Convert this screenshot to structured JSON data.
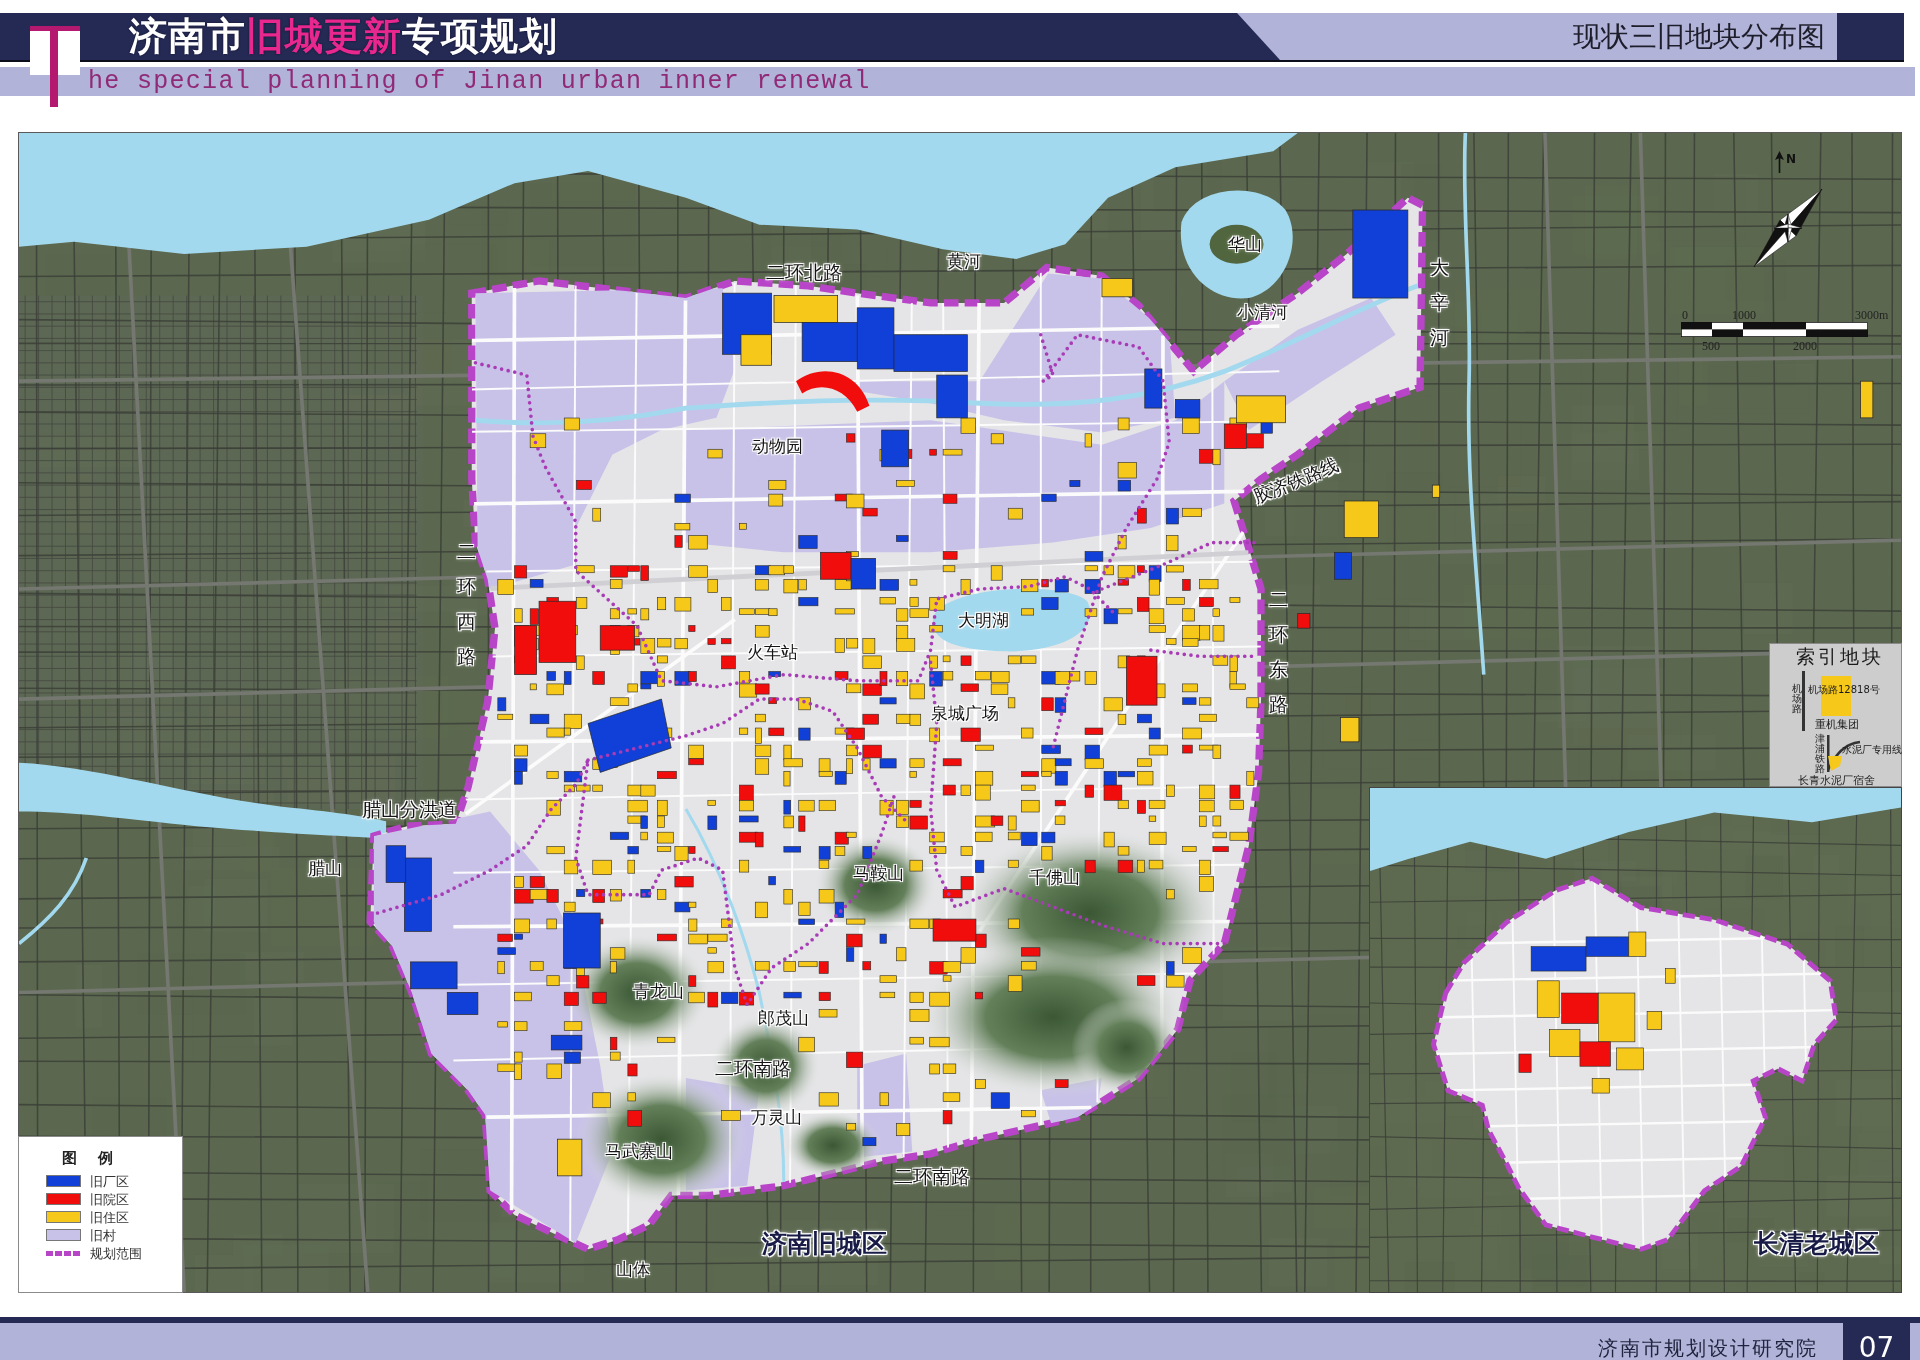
{
  "header": {
    "title_parts": [
      {
        "text": "济南市",
        "highlight": false
      },
      {
        "text": "旧城更新",
        "highlight": true
      },
      {
        "text": "专项规划",
        "highlight": false
      }
    ],
    "subtitle": "he special planning of Jinan urban inner renewal",
    "sheet_title": "现状三旧地块分布图"
  },
  "map": {
    "labels": [
      {
        "text": "二环北路",
        "kind": "road"
      },
      {
        "text": "黄河",
        "kind": "place"
      },
      {
        "text": "华山",
        "kind": "place"
      },
      {
        "text": "小清河",
        "kind": "place"
      },
      {
        "text": "大辛河",
        "kind": "vertical"
      },
      {
        "text": "胶济铁路线",
        "kind": "slanted"
      },
      {
        "text": "动物园",
        "kind": "place"
      },
      {
        "text": "二环西路",
        "kind": "vertical"
      },
      {
        "text": "大明湖",
        "kind": "place"
      },
      {
        "text": "火车站",
        "kind": "place"
      },
      {
        "text": "泉城广场",
        "kind": "place"
      },
      {
        "text": "二环东路",
        "kind": "vertical"
      },
      {
        "text": "腊山分洪道",
        "kind": "road"
      },
      {
        "text": "腊山",
        "kind": "place"
      },
      {
        "text": "马鞍山",
        "kind": "place"
      },
      {
        "text": "千佛山",
        "kind": "place"
      },
      {
        "text": "青龙山",
        "kind": "place"
      },
      {
        "text": "郎茂山",
        "kind": "place"
      },
      {
        "text": "二环南路",
        "kind": "road"
      },
      {
        "text": "万灵山",
        "kind": "place"
      },
      {
        "text": "马武寨山",
        "kind": "place"
      },
      {
        "text": "二环南路",
        "kind": "road"
      },
      {
        "text": "山体",
        "kind": "place"
      }
    ],
    "district_label": "济南旧城区"
  },
  "compass": {
    "north_label": "N"
  },
  "scale_bar": {
    "labels": [
      {
        "text": "0",
        "kind": "above"
      },
      {
        "text": "1000",
        "kind": "above"
      },
      {
        "text": "3000m",
        "kind": "above"
      },
      {
        "text": "500",
        "kind": "below"
      },
      {
        "text": "2000",
        "kind": "below"
      }
    ]
  },
  "index_panel": {
    "title": "索引地块",
    "labels": [
      {
        "text": "机场路",
        "kind": "vertical"
      },
      {
        "text": "机场路12818号",
        "kind": "small"
      },
      {
        "text": "重机集团",
        "kind": "medium"
      },
      {
        "text": "津浦铁路",
        "kind": "vertical"
      },
      {
        "text": "水泥厂专用线",
        "kind": "small"
      },
      {
        "text": "长青水泥厂宿舍",
        "kind": "medium"
      }
    ]
  },
  "inset_map": {
    "label": "长清老城区"
  },
  "legend": {
    "title": "图 例",
    "items": [
      {
        "label": "旧厂区",
        "kind": "fill",
        "color": "#1040d8"
      },
      {
        "label": "旧院区",
        "kind": "fill",
        "color": "#f20d0d"
      },
      {
        "label": "旧住区",
        "kind": "fill",
        "color": "#f5c81a"
      },
      {
        "label": "旧村",
        "kind": "fill",
        "color": "#c8c2e8"
      },
      {
        "label": "规划范围",
        "kind": "line",
        "color": "#b845c8"
      }
    ]
  },
  "footer": {
    "organization": "济南市规划设计研究院",
    "page_number": "07"
  }
}
